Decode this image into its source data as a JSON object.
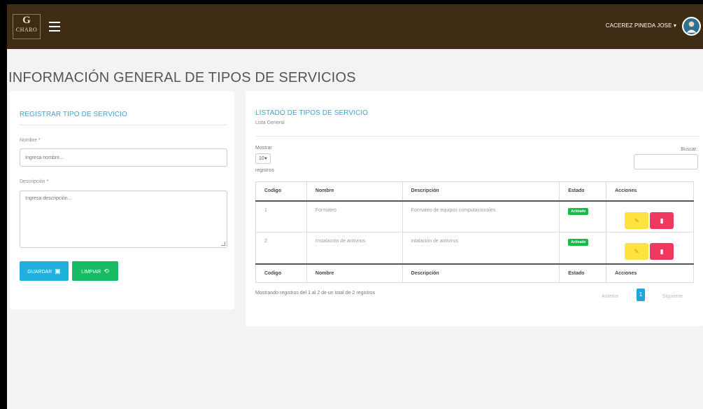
{
  "header": {
    "logo_monogram": "G",
    "logo_text": "CHARO",
    "user_name": "CACEREZ PINEDA JOSE",
    "user_caret": "▾"
  },
  "page": {
    "title": "INFORMACIÓN GENERAL DE TIPOS DE SERVICIOS"
  },
  "form": {
    "title": "REGISTRAR TIPO DE SERVICIO",
    "name_label": "Nombre *",
    "name_placeholder": "Ingresa nombre...",
    "name_value": "",
    "desc_label": "Descripción *",
    "desc_placeholder": "Ingresa descripción...",
    "desc_value": "",
    "save_label": "GUARDAR",
    "save_icon": "floppy-disk-icon",
    "clear_label": "LIMPIAR",
    "clear_icon": "refresh-icon"
  },
  "list": {
    "title": "LISTADO DE TIPOS DE SERVICIO",
    "subtitle": "Lista General",
    "show_label": "Mostrar",
    "page_size": "10",
    "records_label": "registros",
    "search_label": "Buscar:",
    "search_value": "",
    "columns": [
      "Codigo",
      "Nombre",
      "Descripción",
      "Estado",
      "Acciones"
    ],
    "rows": [
      {
        "codigo": "1",
        "nombre": "Formateo",
        "descripcion": "Formateo de equipos computacionales",
        "estado": "Activado"
      },
      {
        "codigo": "2",
        "nombre": "Instalación de antivirus",
        "descripcion": "intalación de antivirus",
        "estado": "Activado"
      }
    ],
    "info": "Mostrando registros del 1 al 2 de un total de 2 registros",
    "prev_label": "Anterior",
    "current_page": "1",
    "next_label": "Siguiente"
  },
  "colors": {
    "topbar": "#3f2c14",
    "accent": "#3fa4d2",
    "save_button": "#1fb0dd",
    "clear_button": "#17bb63",
    "status_active": "#17bb48",
    "edit_button": "#ffe23f",
    "delete_button": "#ef3a5d"
  }
}
